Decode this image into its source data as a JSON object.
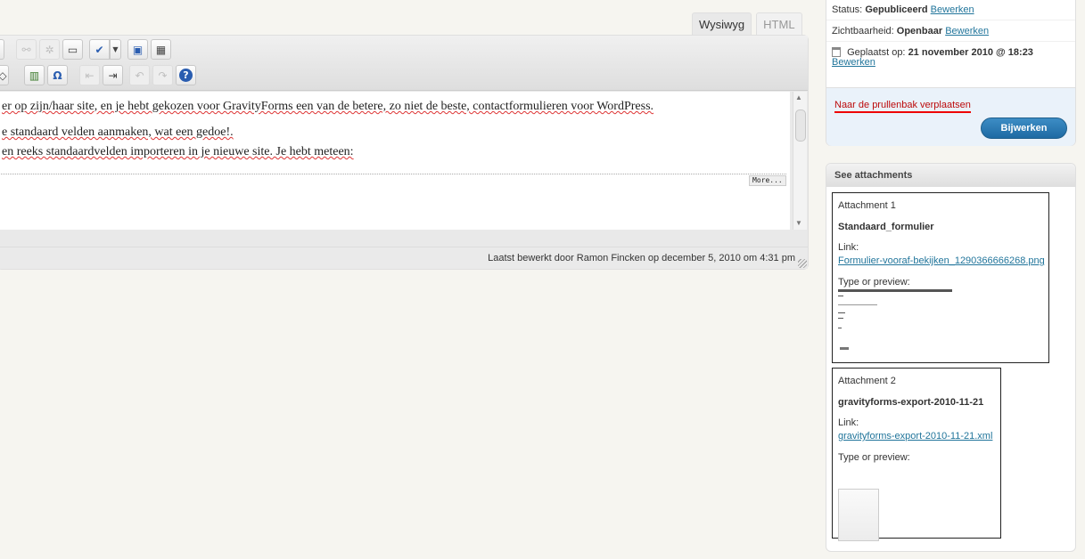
{
  "editor": {
    "tabs": {
      "wysiwyg": "Wysiwyg",
      "html": "HTML"
    },
    "toolbar_row1": [
      "link-icon",
      "unlink-icon",
      "more-icon",
      "spellcheck-icon",
      "dropdown-arrow-icon",
      "fullscreen-icon",
      "kitchen-sink-icon"
    ],
    "toolbar_row2": [
      "eraser-icon",
      "media-icon",
      "omega-icon",
      "outdent-icon",
      "indent-icon",
      "undo-icon",
      "redo-icon",
      "help-icon"
    ],
    "lines": {
      "line1": "er op zijn/haar site, en je hebt gekozen voor GravityForms een van de betere, zo niet de beste, contactformulieren voor WordPress.",
      "line2": "e standaard velden aanmaken, wat een gedoe!.",
      "line3": "en reeks standaardvelden importeren in je nieuwe site. Je hebt meteen:"
    },
    "more_tag": "More...",
    "last_edited": "Laatst bewerkt door Ramon Fincken op december 5, 2010 om 4:31 pm"
  },
  "publish": {
    "status_label": "Status:",
    "status_value": "Gepubliceerd",
    "status_edit": "Bewerken",
    "visibility_label": "Zichtbaarheid:",
    "visibility_value": "Openbaar",
    "visibility_edit": "Bewerken",
    "published_label": "Geplaatst op:",
    "published_value": "21 november 2010 @ 18:23",
    "published_edit": "Bewerken",
    "trash": "Naar de prullenbak verplaatsen",
    "update": "Bijwerken"
  },
  "attachments": {
    "title": "See attachments",
    "items": [
      {
        "heading": "Attachment 1",
        "name": "Standaard_formulier",
        "link_label": "Link:",
        "link": "Formulier-vooraf-bekijken_1290366666268.png",
        "preview_label": "Type or preview:"
      },
      {
        "heading": "Attachment 2",
        "name": "gravityforms-export-2010-11-21",
        "link_label": "Link:",
        "link": "gravityforms-export-2010-11-21.xml",
        "preview_label": "Type or preview:"
      }
    ]
  }
}
